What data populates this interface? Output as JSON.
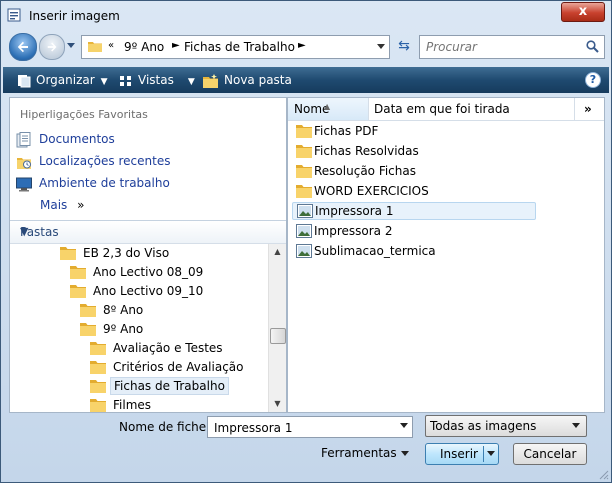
{
  "window": {
    "title": "Inserir imagem",
    "close_label": "x"
  },
  "nav": {
    "breadcrumb": [
      "9º Ano",
      "Fichas de Trabalho"
    ],
    "overflow_marker": "«",
    "search_placeholder": "Procurar"
  },
  "toolbar": {
    "organize_label": "Organizar",
    "views_label": "Vistas",
    "new_folder_label": "Nova pasta",
    "help_label": "?"
  },
  "favorites": {
    "title": "Hiperligações Favoritas",
    "items": [
      {
        "label": "Documentos",
        "icon": "documents-icon"
      },
      {
        "label": "Localizações recentes",
        "icon": "recent-places-icon"
      },
      {
        "label": "Ambiente de trabalho",
        "icon": "desktop-icon"
      }
    ],
    "more_label": "Mais",
    "more_glyph": "»"
  },
  "folders": {
    "title": "Pastas",
    "tree": [
      {
        "label": "EB 2,3 do Viso",
        "level": 0
      },
      {
        "label": "Ano Lectivo 08_09",
        "level": 1
      },
      {
        "label": "Ano Lectivo 09_10",
        "level": 1
      },
      {
        "label": "8º Ano",
        "level": 2
      },
      {
        "label": "9º Ano",
        "level": 2
      },
      {
        "label": "Avaliação e Testes",
        "level": 3
      },
      {
        "label": "Critérios de Avaliação",
        "level": 3
      },
      {
        "label": "Fichas de Trabalho",
        "level": 3,
        "selected": true
      },
      {
        "label": "Filmes",
        "level": 3
      }
    ]
  },
  "files": {
    "columns": {
      "name": "Nome",
      "date": "Data em que foi tirada",
      "more": "»"
    },
    "items": [
      {
        "name": "Fichas PDF",
        "type": "folder"
      },
      {
        "name": "Fichas Resolvidas",
        "type": "folder"
      },
      {
        "name": "Resolução Fichas",
        "type": "folder"
      },
      {
        "name": "WORD EXERCICIOS",
        "type": "folder"
      },
      {
        "name": "Impressora 1",
        "type": "image",
        "selected": true
      },
      {
        "name": "Impressora 2",
        "type": "image"
      },
      {
        "name": "Sublimacao_termica",
        "type": "image"
      }
    ]
  },
  "footer": {
    "filename_label": "Nome de ficheiro:",
    "filename_value": "Impressora 1",
    "filetype_value": "Todas as imagens",
    "tools_label": "Ferramentas",
    "insert_label": "Inserir",
    "cancel_label": "Cancelar"
  },
  "colors": {
    "toolbar_bg": "#1f4a70",
    "link_blue": "#1e3e9a",
    "folder_yellow": "#f2c94c",
    "close_red": "#c8412e"
  }
}
